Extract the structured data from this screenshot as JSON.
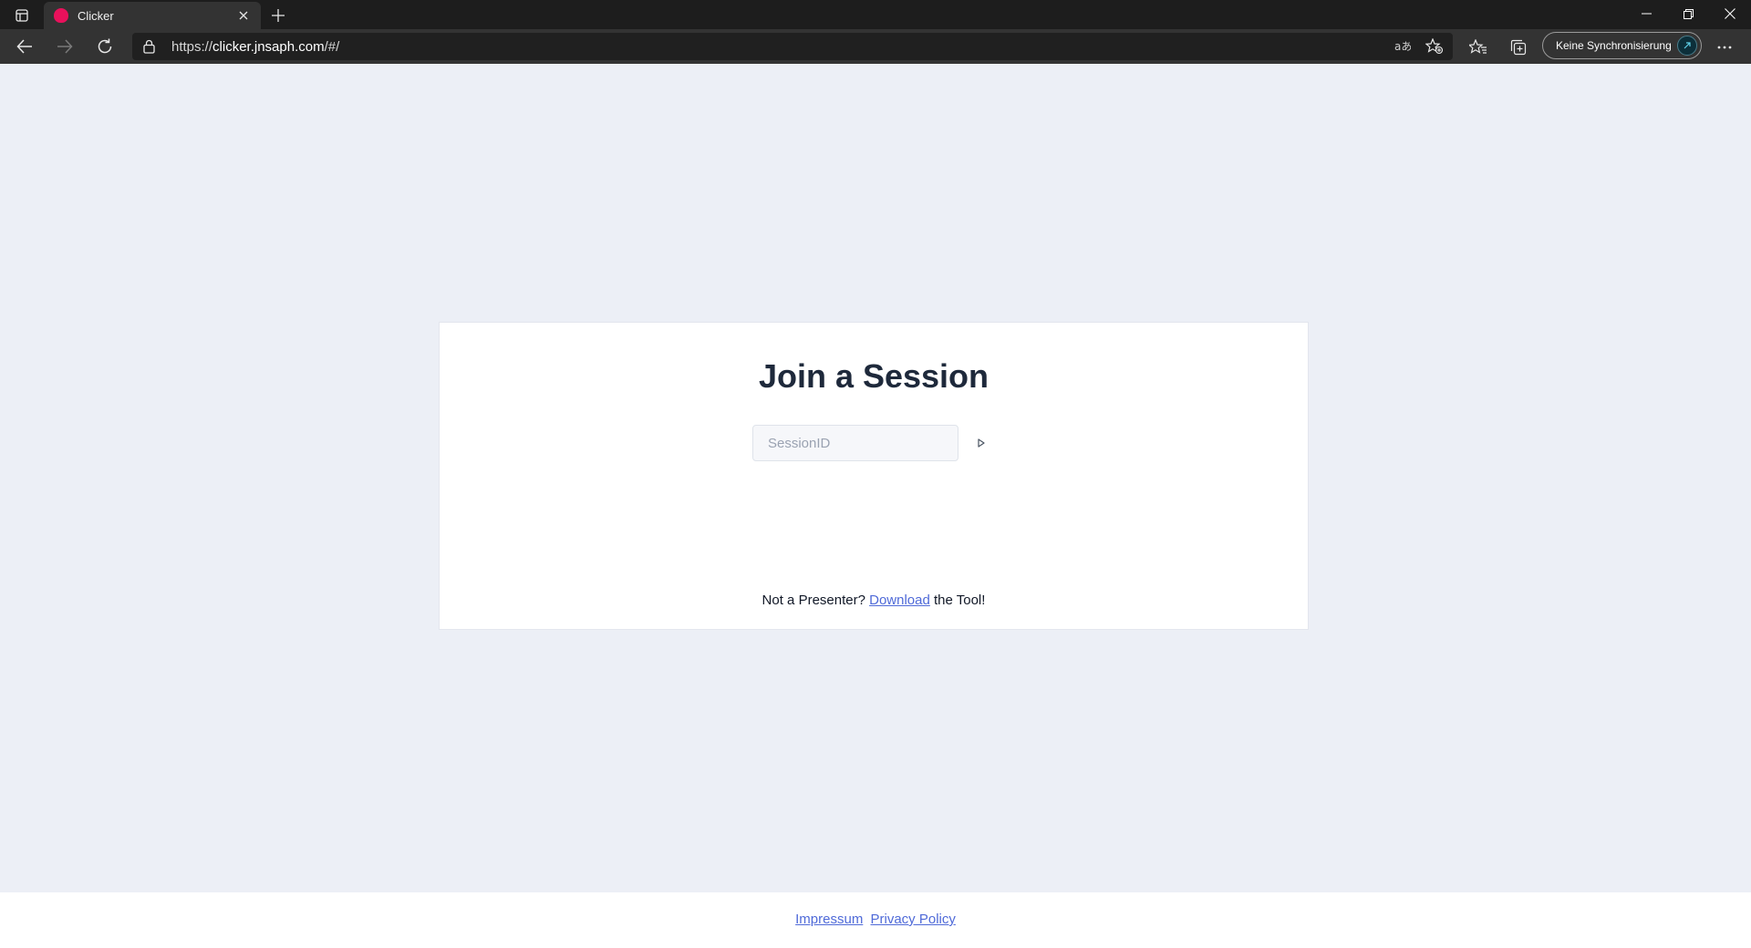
{
  "browser": {
    "tab_title": "Clicker",
    "url_scheme": "https://",
    "url_host": "clicker.jnsaph.com",
    "url_path": "/#/",
    "sync_label": "Keine Synchronisierung",
    "icons": {
      "tab_actions": "tab-actions-icon",
      "close_tab": "close-icon",
      "new_tab": "plus-icon",
      "back": "arrow-left-icon",
      "forward": "arrow-right-icon",
      "refresh": "refresh-icon",
      "lock": "lock-icon",
      "read_aloud": "read-aloud-icon",
      "add_favorite": "star-add-icon",
      "favorites": "favorites-icon",
      "collections": "collections-icon",
      "menu": "more-icon",
      "minimize": "minimize-icon",
      "restore": "restore-icon",
      "close_window": "close-icon"
    }
  },
  "page": {
    "title": "Join a Session",
    "session_placeholder": "SessionID",
    "session_value": "",
    "presenter_prefix": "Not a Presenter? ",
    "download_link": "Download",
    "presenter_suffix": " the Tool!"
  },
  "footer": {
    "impressum": "Impressum",
    "privacy": "Privacy Policy"
  },
  "colors": {
    "page_background": "#eceff6",
    "title_color": "#1e293b",
    "link_color": "#4f6ad8",
    "favicon": "#e8115b",
    "chrome_dark": "#1d1d1d",
    "chrome_toolbar": "#333333"
  }
}
